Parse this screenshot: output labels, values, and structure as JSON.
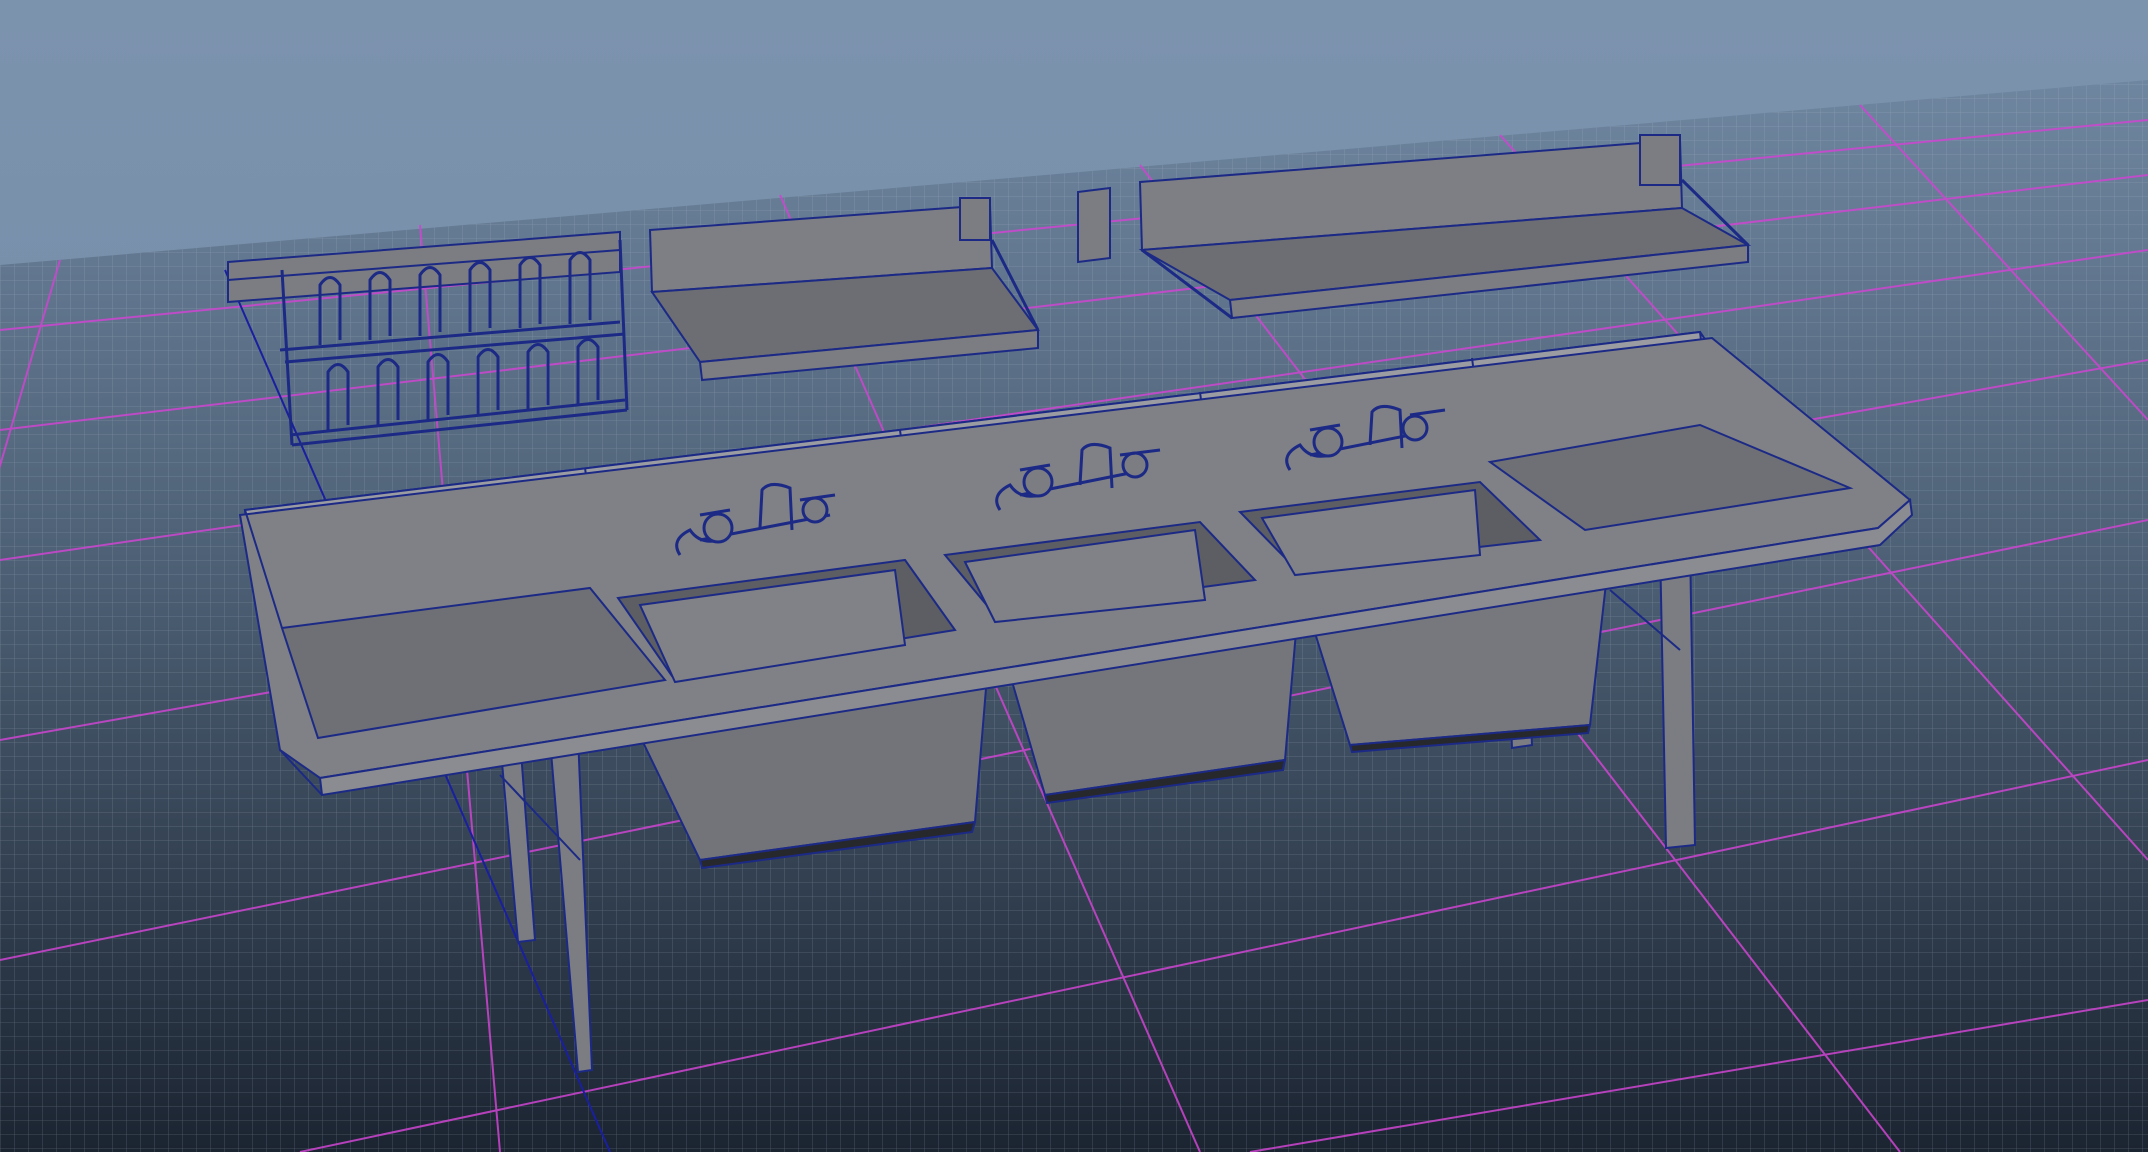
{
  "viewport": {
    "panel": "3d-perspective-viewport",
    "shading": "wireframe-on-shaded",
    "background_top": "#7f97b3",
    "background_horizon": "#6e8aa6",
    "floor_grid_color": "#b9c6d6",
    "major_grid_color": "#d84ad8",
    "wireframe_color": "#1c2a86",
    "surface_color": "#7b7d82"
  },
  "scene_objects": [
    {
      "name": "plate-rack",
      "icon": "plate-rack-mesh"
    },
    {
      "name": "small-wall-shelf",
      "icon": "shelf-mesh"
    },
    {
      "name": "long-wall-shelf",
      "icon": "shelf-mesh"
    },
    {
      "name": "three-compartment-sink",
      "icon": "sink-mesh"
    }
  ]
}
